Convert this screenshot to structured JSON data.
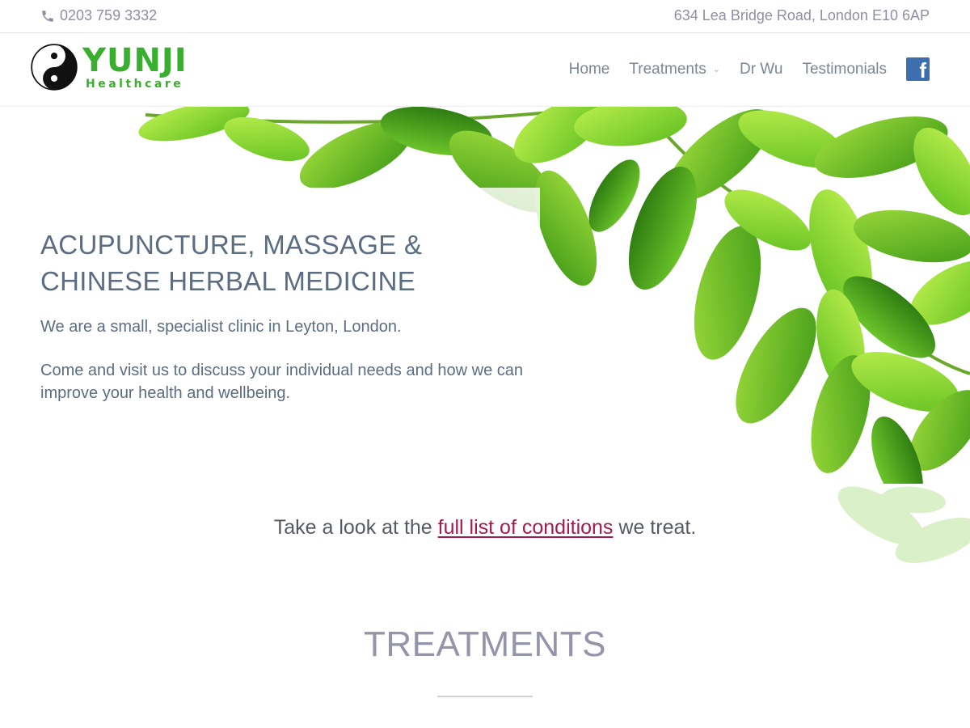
{
  "topbar": {
    "phone": "0203 759 3332",
    "phone_icon": "phone-icon",
    "address": "634 Lea Bridge Road, London E10 6AP"
  },
  "brand": {
    "name": "YUNJI",
    "tagline": "Healthcare",
    "logo_icon": "yin-yang-icon",
    "color": "#3aae2f"
  },
  "nav": {
    "items": [
      {
        "label": "Home"
      },
      {
        "label": "Treatments",
        "has_dropdown": true
      },
      {
        "label": "Dr Wu"
      },
      {
        "label": "Testimonials"
      }
    ],
    "facebook_icon": "facebook-icon",
    "facebook_color": "#3b6fb0"
  },
  "hero": {
    "title": "ACUPUNCTURE, MASSAGE & CHINESE HERBAL MEDICINE",
    "text1": "We are a small, specialist clinic in Leyton, London.",
    "text2": "Come and visit us to discuss your individual needs and how we can improve your health and wellbeing."
  },
  "conditions": {
    "prefix": "Take a look at the",
    "link": "full list of conditions",
    "suffix": "we treat.",
    "link_color": "#a31b4f"
  },
  "treatments": {
    "heading": "TREATMENTS"
  }
}
